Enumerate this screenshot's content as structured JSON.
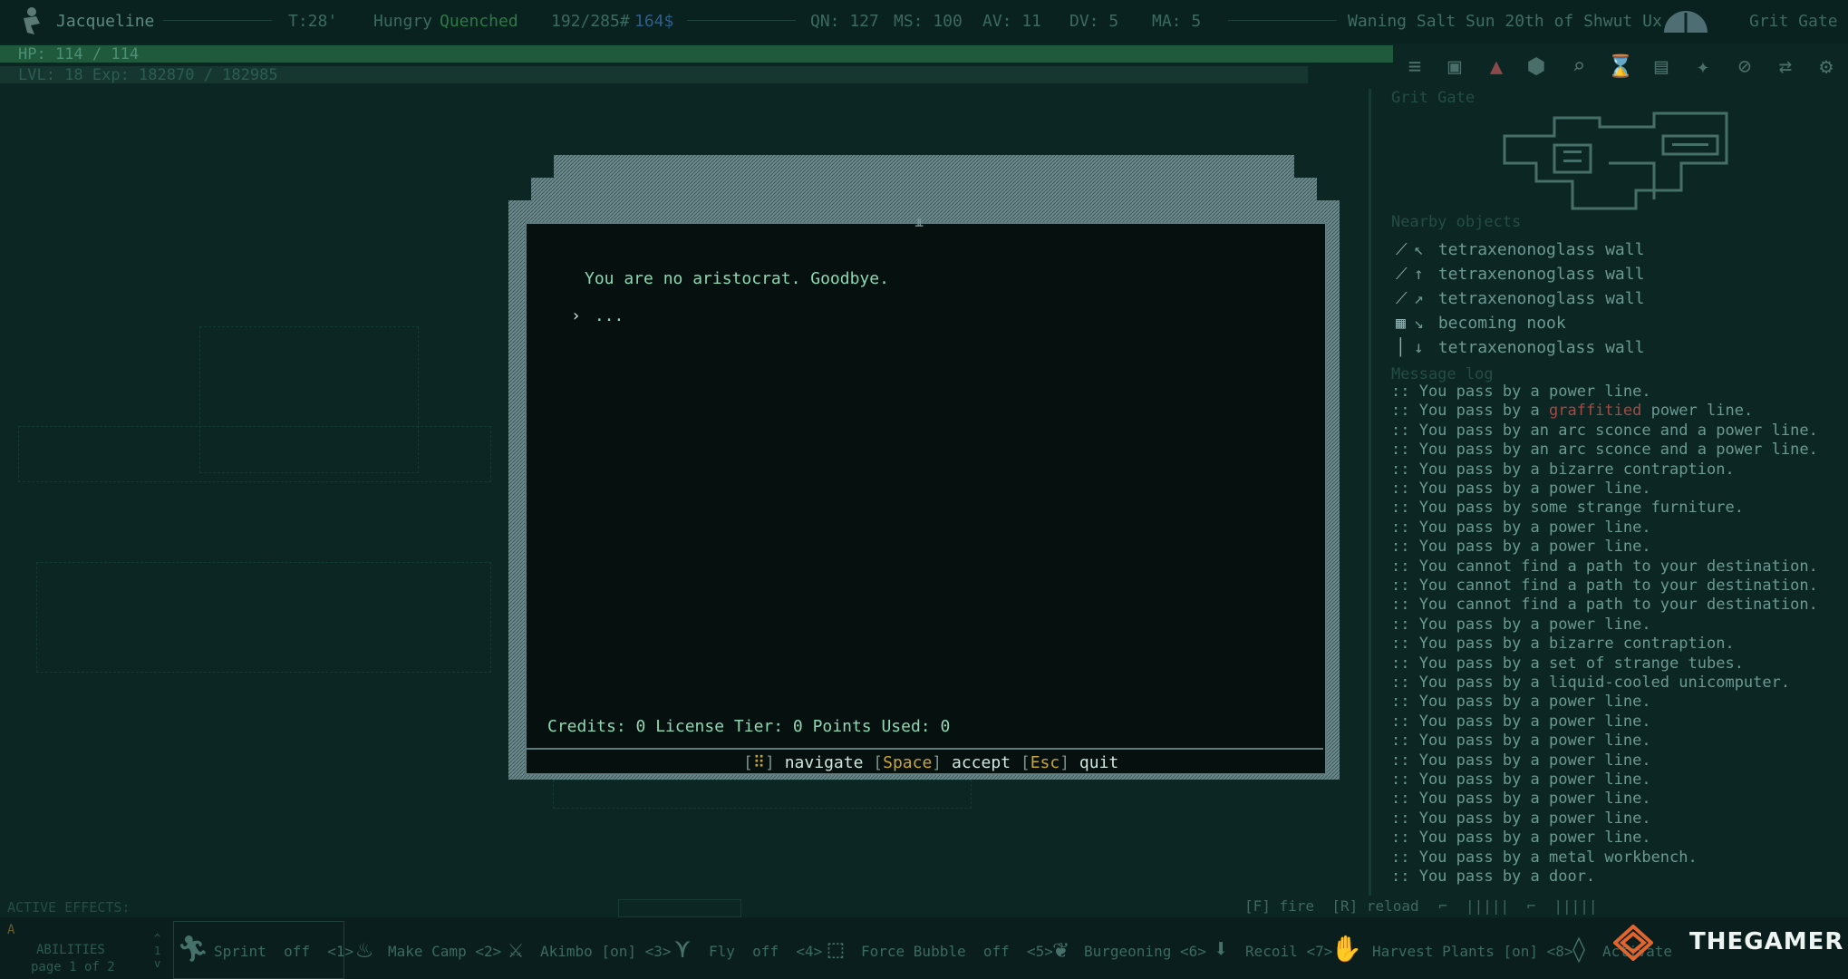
{
  "status": {
    "character_name": "Jacqueline",
    "turn": "T:28'",
    "hunger": "Hungry",
    "thirst": "Quenched",
    "weight": "192/285#",
    "money": "164$",
    "quickness": "QN: 127",
    "move_speed": "MS: 100",
    "armor": "AV: 11",
    "dodge": "DV: 5",
    "mental_armor": "MA: 5",
    "date": "Waning Salt Sun 20th of Shwut Ux",
    "zone": "Grit Gate",
    "hp_text": "HP: 114 / 114",
    "hp_fraction": 1.0,
    "level_text": "LVL: 18 Exp: 182870 / 182985",
    "exp_fraction": 0.999
  },
  "dialog": {
    "speech": "You are no aristocrat. Goodbye.",
    "option_marker": "›",
    "option": "...",
    "credits_line": "Credits: 0 License Tier: 0 Points Used: 0",
    "keys": {
      "navigate_label": "navigate",
      "accept_key": "Space",
      "accept_label": "accept",
      "quit_key": "Esc",
      "quit_label": "quit"
    }
  },
  "sidebar": {
    "zone_title": "Grit Gate",
    "nearby_title": "Nearby objects",
    "nearby": [
      {
        "icon": "wall-icon",
        "arrow": "↖",
        "label": "tetraxenonoglass wall"
      },
      {
        "icon": "wall-icon",
        "arrow": "↑",
        "label": "tetraxenonoglass wall"
      },
      {
        "icon": "wall-icon",
        "arrow": "↗",
        "label": "tetraxenonoglass wall"
      },
      {
        "icon": "nook-icon",
        "arrow": "↘",
        "label": "becoming nook"
      },
      {
        "icon": "wall-icon",
        "arrow": "↓",
        "label": "tetraxenonoglass wall"
      }
    ],
    "log_title": "Message log",
    "log": [
      ":: You pass by a power line.",
      ":: You pass by a |graffitied| power line.",
      ":: You pass by an arc sconce and a power line.",
      ":: You pass by an arc sconce and a power line.",
      ":: You pass by a bizarre contraption.",
      ":: You pass by a power line.",
      ":: You pass by some strange furniture.",
      ":: You pass by a power line.",
      ":: You pass by a power line.",
      ":: You cannot find a path to your destination.",
      ":: You cannot find a path to your destination.",
      ":: You cannot find a path to your destination.",
      ":: You pass by a power line.",
      ":: You pass by a bizarre contraption.",
      ":: You pass by a set of strange tubes.",
      ":: You pass by a liquid-cooled unicomputer.",
      ":: You pass by a power line.",
      ":: You pass by a power line.",
      ":: You pass by a power line.",
      ":: You pass by a power line.",
      ":: You pass by a power line.",
      ":: You pass by a power line.",
      ":: You pass by a power line.",
      ":: You pass by a power line.",
      ":: You pass by a metal workbench.",
      ":: You pass by a door."
    ]
  },
  "bottom": {
    "active_effects": "ACTIVE EFFECTS:",
    "fire": "[F] fire",
    "reload": "[R] reload",
    "abilities_label": "ABILITIES",
    "abilities_page": "page 1 of 2",
    "abilities": [
      {
        "name": "Sprint",
        "state": "off",
        "key": "<1>"
      },
      {
        "name": "Make Camp",
        "state": "",
        "key": "<2>"
      },
      {
        "name": "Akimbo",
        "state": "[on]",
        "key": "<3>"
      },
      {
        "name": "Fly",
        "state": "off",
        "key": "<4>"
      },
      {
        "name": "Force Bubble",
        "state": "off",
        "key": "<5>"
      },
      {
        "name": "Burgeoning",
        "state": "",
        "key": "<6>"
      },
      {
        "name": "Recoil",
        "state": "",
        "key": "<7>"
      },
      {
        "name": "Harvest Plants",
        "state": "[on]",
        "key": "<8>"
      },
      {
        "name": "Activate",
        "state": "",
        "key": ""
      }
    ],
    "watermark": "THEGAMER"
  },
  "colors": {
    "background": "#0c2623",
    "dialog_text": "#8cd8b4",
    "key_highlight": "#c9a43b",
    "hp_bar": "#1f5a3c"
  }
}
